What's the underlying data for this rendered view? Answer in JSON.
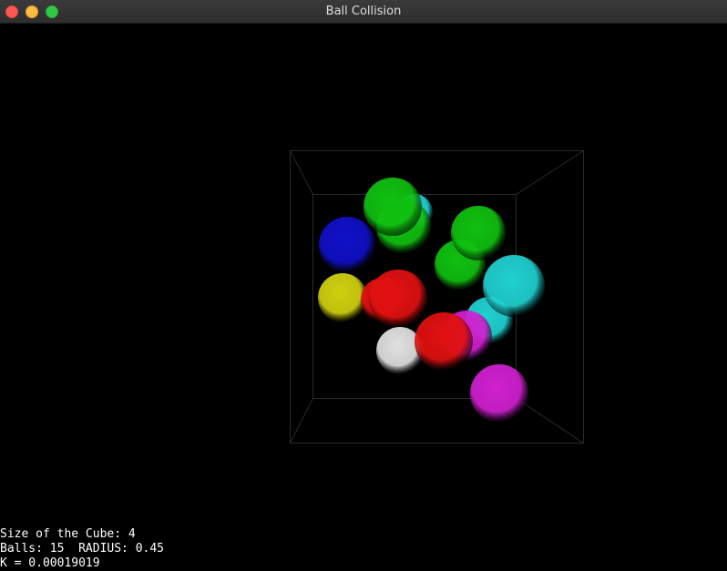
{
  "window": {
    "title": "Ball Collision"
  },
  "hud": {
    "cube_size": "Size of the Cube: 4",
    "balls_radius": "Balls: 15  RADIUS: 0.45",
    "k_value": "K = 0.00019019"
  },
  "colors": {
    "cube_edges": "#2a2a2a",
    "red": "#e01010",
    "green": "#10c010",
    "blue": "#1010c8",
    "cyan": "#20d0d0",
    "magenta": "#d020d0",
    "yellow": "#d0d010",
    "white": "#e0e0e0"
  },
  "scene": {
    "ball_count": 15,
    "balls": [
      {
        "color": "cyan"
      },
      {
        "color": "green"
      },
      {
        "color": "green"
      },
      {
        "color": "blue"
      },
      {
        "color": "green"
      },
      {
        "color": "green"
      },
      {
        "color": "cyan"
      },
      {
        "color": "yellow"
      },
      {
        "color": "red"
      },
      {
        "color": "red"
      },
      {
        "color": "cyan"
      },
      {
        "color": "magenta"
      },
      {
        "color": "white"
      },
      {
        "color": "red"
      },
      {
        "color": "magenta"
      }
    ]
  }
}
